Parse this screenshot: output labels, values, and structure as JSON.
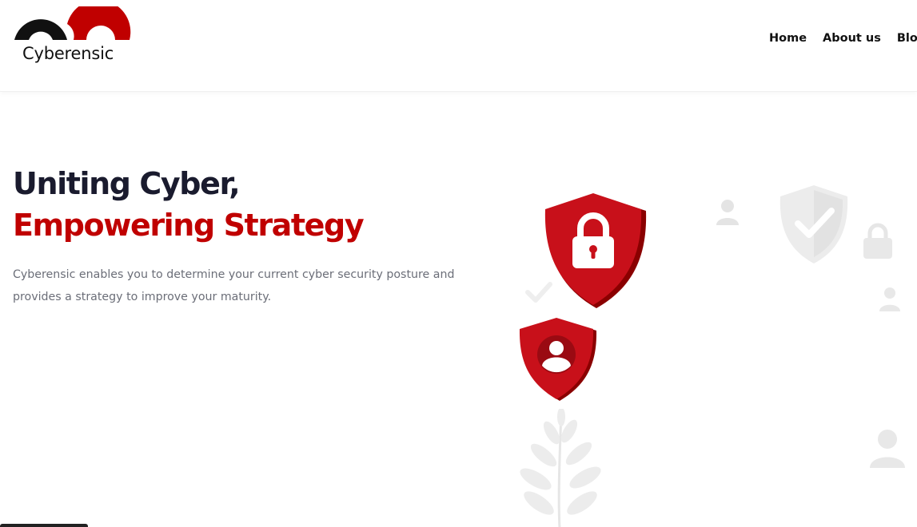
{
  "brand": {
    "name": "Cyberensic",
    "colors": {
      "red": "#c00000",
      "black": "#111111"
    }
  },
  "nav": {
    "items": [
      {
        "label": "Home"
      },
      {
        "label": "About us"
      },
      {
        "label": "Blog"
      }
    ]
  },
  "hero": {
    "title_line1": "Uniting Cyber,",
    "title_line2": "Empowering Strategy",
    "description": "Cyberensic enables you to determine your current cyber security posture and provides a strategy to improve your maturity.",
    "colors": {
      "heading": "#1a1b2e",
      "accent": "#c00000",
      "body": "#6b6e78"
    }
  },
  "illustration": {
    "icons": [
      "padlock-shield-icon",
      "user-shield-icon",
      "checkmark-shield-icon",
      "padlock-icon",
      "user-icon",
      "check-icon",
      "plant-icon"
    ]
  }
}
